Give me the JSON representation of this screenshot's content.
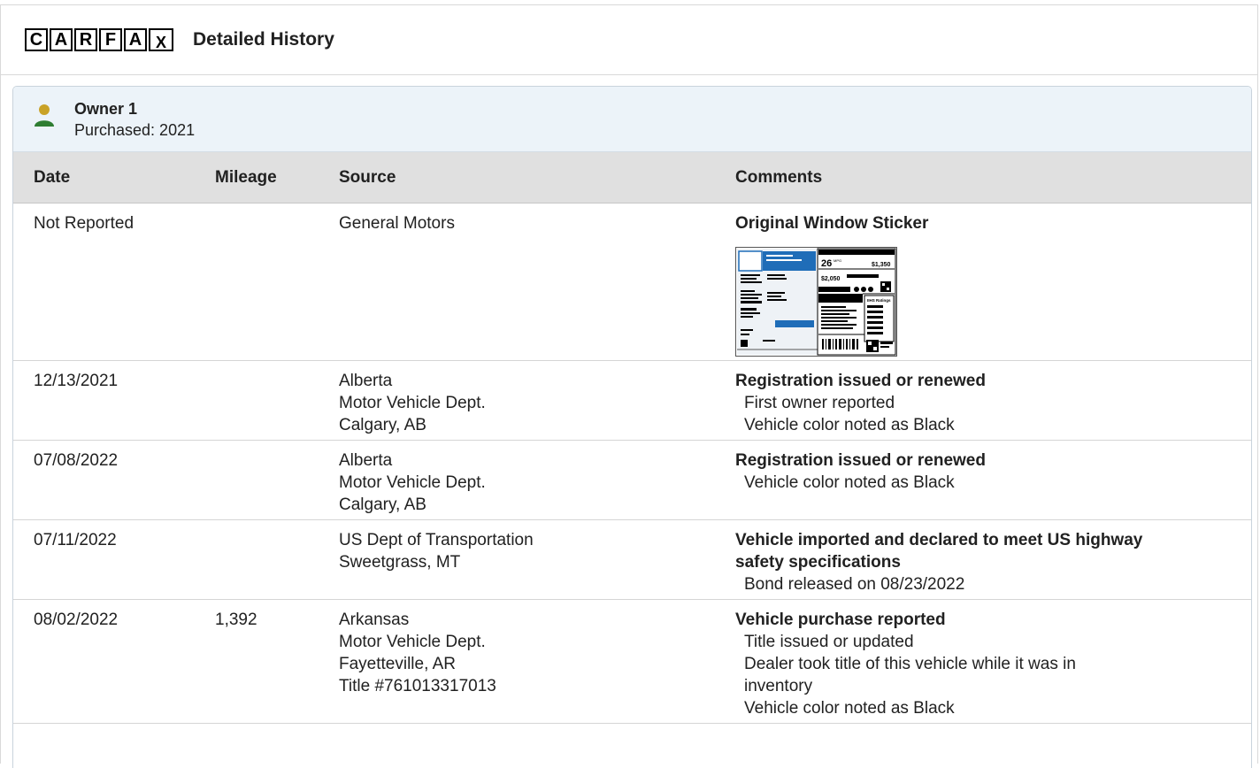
{
  "header": {
    "logo_letters": [
      "C",
      "A",
      "R",
      "F",
      "A",
      "X"
    ],
    "title": "Detailed History"
  },
  "owner": {
    "name": "Owner 1",
    "purchased": "Purchased: 2021",
    "icon": "person-icon",
    "icon_colors": {
      "head": "#c9a227",
      "body": "#2e7d32"
    }
  },
  "table": {
    "headers": {
      "date": "Date",
      "mileage": "Mileage",
      "source": "Source",
      "comments": "Comments"
    },
    "rows": [
      {
        "date": "Not Reported",
        "mileage": "",
        "source": [
          "General Motors"
        ],
        "comment_title": [
          "Original Window Sticker"
        ],
        "comment_details": [],
        "sticker": {
          "mpg": "26",
          "mpg_unit": "MPG",
          "savings": "$1,350",
          "annual_cost": "$2,050",
          "ratings_label": "IIHS Ratings"
        }
      },
      {
        "date": "12/13/2021",
        "mileage": "",
        "source": [
          "Alberta",
          "Motor Vehicle Dept.",
          "Calgary, AB"
        ],
        "comment_title": [
          "Registration issued or renewed"
        ],
        "comment_details": [
          "First owner reported",
          "Vehicle color noted as Black"
        ]
      },
      {
        "date": "07/08/2022",
        "mileage": "",
        "source": [
          "Alberta",
          "Motor Vehicle Dept.",
          "Calgary, AB"
        ],
        "comment_title": [
          "Registration issued or renewed"
        ],
        "comment_details": [
          "Vehicle color noted as Black"
        ]
      },
      {
        "date": "07/11/2022",
        "mileage": "",
        "source": [
          "US Dept of Transportation",
          "Sweetgrass, MT"
        ],
        "comment_title": [
          "Vehicle imported and declared to meet US highway",
          "safety specifications"
        ],
        "comment_details": [
          "Bond released on 08/23/2022"
        ]
      },
      {
        "date": "08/02/2022",
        "mileage": "1,392",
        "source": [
          "Arkansas",
          "Motor Vehicle Dept.",
          "Fayetteville, AR",
          "Title #761013317013"
        ],
        "comment_title": [
          "Vehicle purchase reported"
        ],
        "comment_details": [
          "Title issued or updated",
          "Dealer took title of this vehicle while it was in",
          "inventory",
          "Vehicle color noted as Black"
        ]
      }
    ]
  }
}
